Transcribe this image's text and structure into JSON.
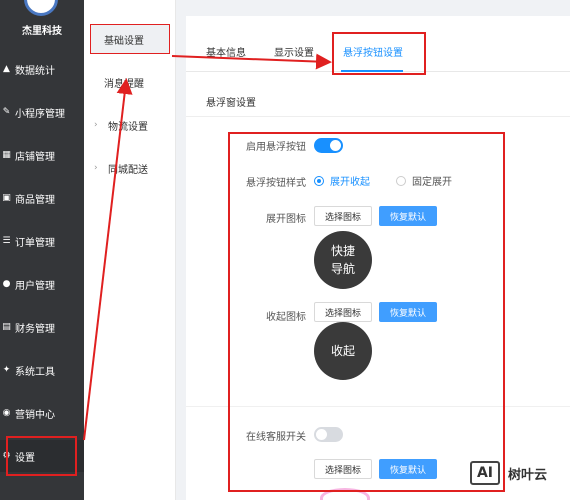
{
  "sidebar": {
    "brand": "杰里科技",
    "items": [
      {
        "label": "数据统计",
        "icon": "chart-icon"
      },
      {
        "label": "小程序管理",
        "icon": "edit-icon"
      },
      {
        "label": "店铺管理",
        "icon": "store-icon"
      },
      {
        "label": "商品管理",
        "icon": "goods-icon"
      },
      {
        "label": "订单管理",
        "icon": "order-icon"
      },
      {
        "label": "用户管理",
        "icon": "user-icon"
      },
      {
        "label": "财务管理",
        "icon": "finance-icon"
      },
      {
        "label": "系统工具",
        "icon": "wrench-icon"
      },
      {
        "label": "营销中心",
        "icon": "marketing-icon"
      },
      {
        "label": "设置",
        "icon": "gear-icon"
      }
    ]
  },
  "sub_sidebar": {
    "items": [
      {
        "label": "基础设置"
      },
      {
        "label": "消息提醒"
      },
      {
        "label": "物流设置"
      },
      {
        "label": "同城配送"
      }
    ]
  },
  "tabs": [
    {
      "label": "基本信息"
    },
    {
      "label": "显示设置"
    },
    {
      "label": "悬浮按钮设置"
    }
  ],
  "section_title": "悬浮窗设置",
  "form": {
    "enable_label": "启用悬浮按钮",
    "style_label": "悬浮按钮样式",
    "style_options": [
      "展开收起",
      "固定展开"
    ],
    "expand_icon_label": "展开图标",
    "collapse_icon_label": "收起图标",
    "choose_icon": "选择图标",
    "restore_default": "恢复默认",
    "expand_circle_text": "快捷\n导航",
    "collapse_circle_text": "收起",
    "online_service_label": "在线客服开关"
  },
  "watermark": {
    "ai": "AI",
    "text": "树叶云"
  },
  "colors": {
    "accent": "#1890ff",
    "primary_button": "#409eff",
    "sidebar": "#343639",
    "annotation": "#e02020"
  }
}
